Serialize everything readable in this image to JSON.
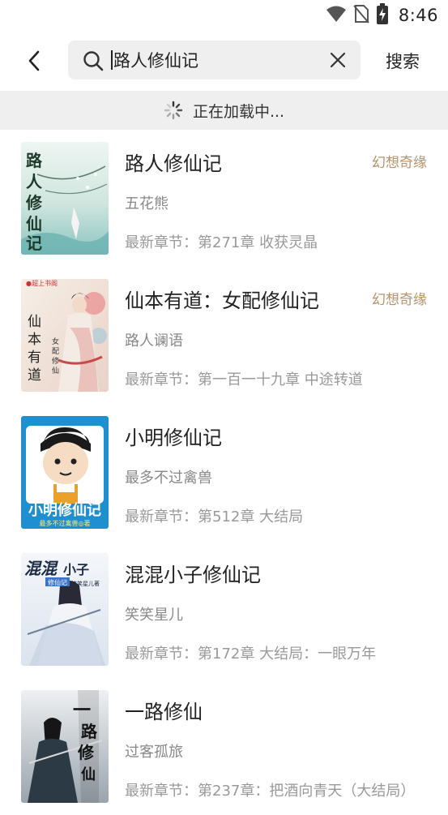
{
  "status_bar": {
    "time": "8:46",
    "icons": [
      "wifi-icon",
      "no-sim-icon",
      "battery-charging-icon"
    ]
  },
  "search": {
    "query": "路人修仙记",
    "button_label": "搜索"
  },
  "loading": {
    "text": "正在加载中..."
  },
  "results": [
    {
      "title": "路人修仙记",
      "author": "五花熊",
      "latest": "最新章节：第271章 收获灵晶",
      "category": "幻想奇缘",
      "cover_text": "路人修仙记"
    },
    {
      "title": "仙本有道：女配修仙记",
      "author": "路人谰语",
      "latest": "最新章节：第一百一十九章 中途转道",
      "category": "幻想奇缘",
      "cover_text": "仙本有道"
    },
    {
      "title": "小明修仙记",
      "author": "最多不过禽兽",
      "latest": "最新章节：第512章 大结局",
      "category": "",
      "cover_text": "小明修仙记"
    },
    {
      "title": "混混小子修仙记",
      "author": "笑笑星儿",
      "latest": "最新章节：第172章 大结局：一眼万年",
      "category": "",
      "cover_text": "混混小子"
    },
    {
      "title": "一路修仙",
      "author": "过客孤旅",
      "latest": "最新章节：第237章：把酒向青天（大结局）",
      "category": "",
      "cover_text": "一路修仙"
    }
  ],
  "colors": {
    "accent_category": "#b8916a",
    "loading_bg": "#efefef",
    "search_bg": "#efefef"
  }
}
